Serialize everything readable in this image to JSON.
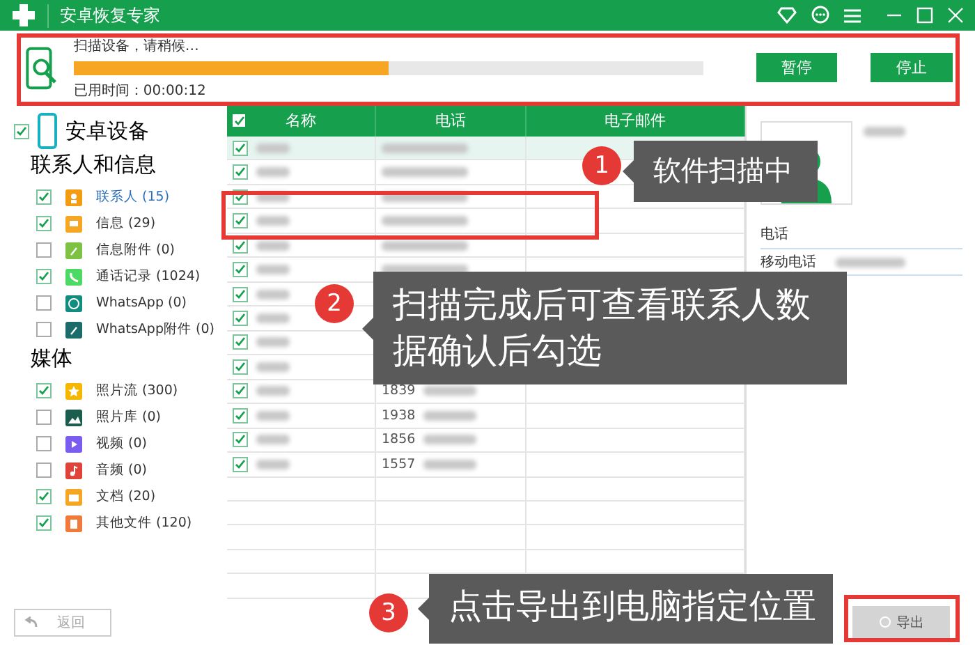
{
  "window": {
    "title": "安卓恢复专家"
  },
  "scan": {
    "status": "扫描设备，请稍候…",
    "progress": {
      "level": 0.5
    },
    "elapsed": "已用时间：00:00:12",
    "buttons": [
      {
        "label": "暂停"
      },
      {
        "label": "停止"
      }
    ]
  },
  "sidebar": {
    "device": {
      "label": "安卓设备",
      "checked": true
    },
    "groups": [
      {
        "title": "联系人和信息",
        "items": [
          {
            "label": "联系人 (15)",
            "checked": true,
            "selected": true,
            "kind": "contact",
            "color": "#f39c12"
          },
          {
            "label": "信息 (29)",
            "checked": true,
            "selected": false,
            "kind": "message",
            "color": "#f5a623"
          },
          {
            "label": "信息附件 (0)",
            "checked": false,
            "selected": false,
            "kind": "attachment",
            "color": "#7dc242"
          },
          {
            "label": "通话记录 (1024)",
            "checked": true,
            "selected": false,
            "kind": "call",
            "color": "#4cd964"
          },
          {
            "label": "WhatsApp (0)",
            "checked": false,
            "selected": false,
            "kind": "whatsapp",
            "color": "#128c7e"
          },
          {
            "label": "WhatsApp附件 (0)",
            "checked": false,
            "selected": false,
            "kind": "attachment",
            "color": "#1b6b6b"
          }
        ]
      },
      {
        "title": "媒体",
        "items": [
          {
            "label": "照片流 (300)",
            "checked": true,
            "selected": false,
            "kind": "star",
            "color": "#f5b700"
          },
          {
            "label": "照片库 (0)",
            "checked": false,
            "selected": false,
            "kind": "photo",
            "color": "#1b5e50"
          },
          {
            "label": "视频 (0)",
            "checked": false,
            "selected": false,
            "kind": "video",
            "color": "#7b5cf0"
          },
          {
            "label": "音频 (0)",
            "checked": false,
            "selected": false,
            "kind": "audio",
            "color": "#e0433a"
          },
          {
            "label": "文档 (20)",
            "checked": true,
            "selected": false,
            "kind": "folder",
            "color": "#f5a623"
          },
          {
            "label": "其他文件 (120)",
            "checked": true,
            "selected": false,
            "kind": "file",
            "color": "#f07a3a"
          }
        ]
      }
    ]
  },
  "table": {
    "header_checked": true,
    "columns": [
      "名称",
      "电话",
      "电子邮件"
    ],
    "rows": [
      {
        "checked": true,
        "selected": true
      },
      {
        "checked": true,
        "selected": false
      },
      {
        "checked": true,
        "selected": false
      },
      {
        "checked": true,
        "selected": false
      },
      {
        "checked": true,
        "selected": false
      },
      {
        "checked": true,
        "selected": false
      },
      {
        "checked": true,
        "selected": false
      },
      {
        "checked": true,
        "selected": false
      },
      {
        "checked": true,
        "selected": false
      },
      {
        "checked": true,
        "selected": false
      },
      {
        "checked": true,
        "selected": false,
        "phone": "1839"
      },
      {
        "checked": true,
        "selected": false,
        "phone": "1938"
      },
      {
        "checked": true,
        "selected": false,
        "phone": "1856"
      },
      {
        "checked": true,
        "selected": false,
        "phone": "1557"
      }
    ]
  },
  "detail": {
    "section": "电话",
    "field_label": "移动电话"
  },
  "footer": {
    "back": {
      "label": "返回",
      "disabled": true
    },
    "export": {
      "label": "导出",
      "disabled": true
    }
  },
  "callouts": [
    {
      "number": "1",
      "text": "软件扫描中"
    },
    {
      "number": "2",
      "text": "扫描完成后可查看联系人数据确认后勾选"
    },
    {
      "number": "3",
      "text": "点击导出到电脑指定位置"
    }
  ]
}
